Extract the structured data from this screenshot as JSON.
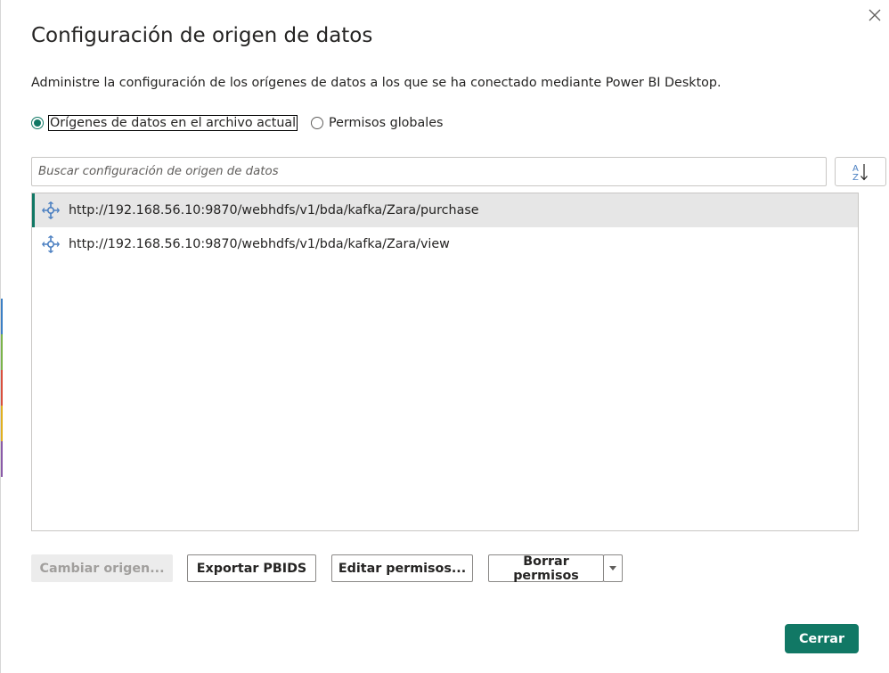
{
  "dialog": {
    "title": "Configuración de origen de datos",
    "description": "Administre la configuración de los orígenes de datos a los que se ha conectado mediante Power BI Desktop.",
    "close_icon": "close-icon"
  },
  "scope": {
    "options": [
      {
        "label": "Orígenes de datos en el archivo actual",
        "checked": true
      },
      {
        "label": "Permisos globales",
        "checked": false
      }
    ]
  },
  "search": {
    "placeholder": "Buscar configuración de origen de datos",
    "value": ""
  },
  "sort": {
    "icon": "sort-az-icon"
  },
  "sources": [
    {
      "url": "http://192.168.56.10:9870/webhdfs/v1/bda/kafka/Zara/purchase",
      "selected": true,
      "icon": "web-source-icon"
    },
    {
      "url": "http://192.168.56.10:9870/webhdfs/v1/bda/kafka/Zara/view",
      "selected": false,
      "icon": "web-source-icon"
    }
  ],
  "actions": {
    "change_source": "Cambiar origen...",
    "export_pbids": "Exportar PBIDS",
    "edit_permissions": "Editar permisos...",
    "clear_permissions": "Borrar permisos",
    "close": "Cerrar"
  },
  "colors": {
    "accent": "#117865",
    "icon_blue": "#4a7fc1"
  }
}
